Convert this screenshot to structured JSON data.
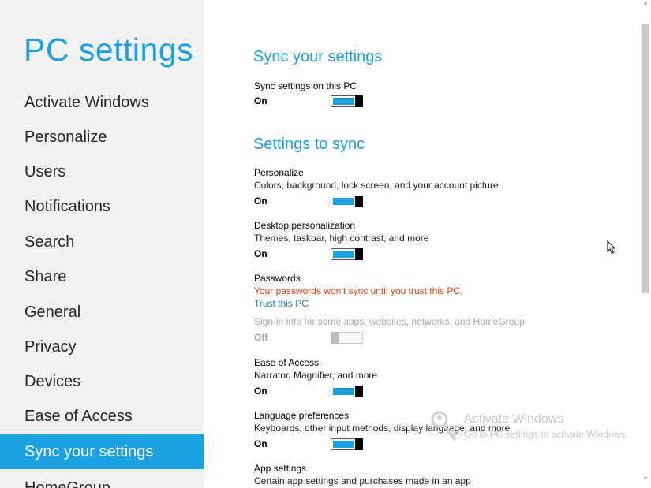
{
  "app": {
    "title": "PC settings"
  },
  "sidebar": {
    "items": [
      {
        "label": "Activate Windows"
      },
      {
        "label": "Personalize"
      },
      {
        "label": "Users"
      },
      {
        "label": "Notifications"
      },
      {
        "label": "Search"
      },
      {
        "label": "Share"
      },
      {
        "label": "General"
      },
      {
        "label": "Privacy"
      },
      {
        "label": "Devices"
      },
      {
        "label": "Ease of Access"
      },
      {
        "label": "Sync your settings",
        "selected": true
      },
      {
        "label": "HomeGroup"
      }
    ]
  },
  "main": {
    "heading": "Sync your settings",
    "sync_on_pc": {
      "label": "Sync settings on this PC",
      "state": "On"
    },
    "settings_heading": "Settings to sync",
    "personalize": {
      "label": "Personalize",
      "description": "Colors, background, lock screen, and your account picture",
      "state": "On"
    },
    "desktop": {
      "label": "Desktop personalization",
      "description": "Themes, taskbar, high contrast, and more",
      "state": "On"
    },
    "passwords": {
      "label": "Passwords",
      "warning": "Your passwords won’t sync until you trust this PC.",
      "link": "Trust this PC",
      "description": "Sign-in info for some apps, websites, networks, and HomeGroup",
      "state": "Off"
    },
    "ease": {
      "label": "Ease of Access",
      "description": "Narrator, Magnifier, and more",
      "state": "On"
    },
    "language": {
      "label": "Language preferences",
      "description": "Keyboards, other input methods, display language, and more",
      "state": "On"
    },
    "app_settings": {
      "label": "App settings",
      "description": "Certain app settings and purchases made in an app"
    }
  },
  "watermark": {
    "title": "Activate Windows",
    "subtitle": "Go to PC settings to activate Windows."
  },
  "colors": {
    "accent": "#1ba1e2",
    "warning": "#e03c00",
    "link": "#1a73c8",
    "sidebar_bg": "#f2f2f2"
  },
  "icons": {
    "scroll_up": "chevron-up-icon",
    "scroll_down": "chevron-down-icon",
    "watermark": "key-icon",
    "cursor": "mouse-pointer-icon"
  }
}
